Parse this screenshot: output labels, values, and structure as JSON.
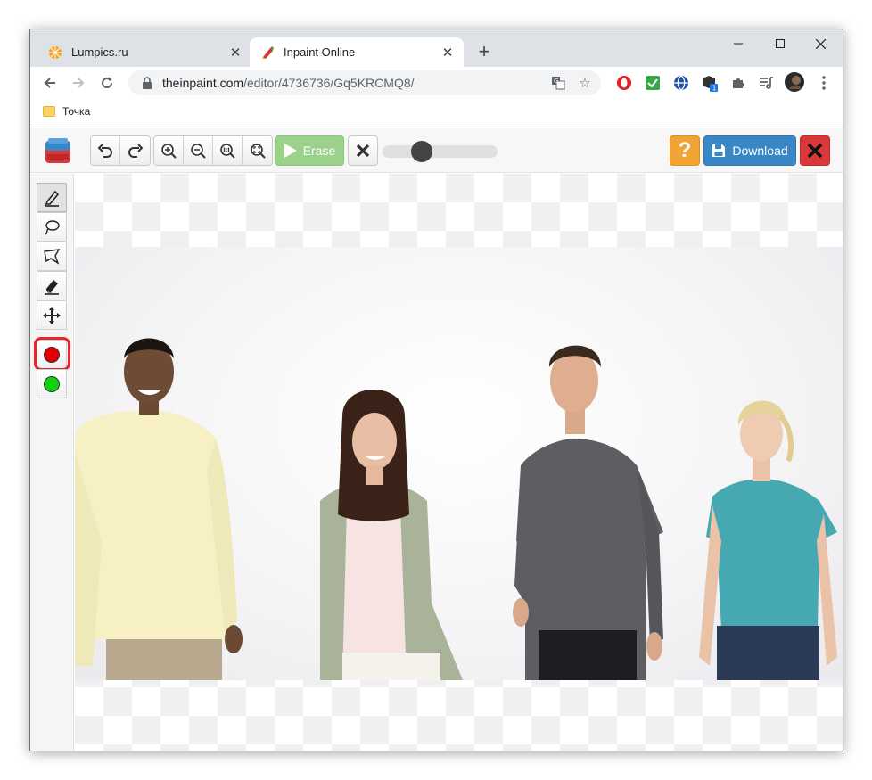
{
  "browser": {
    "tabs": [
      {
        "title": "Lumpics.ru",
        "active": false
      },
      {
        "title": "Inpaint Online",
        "active": true
      }
    ],
    "url_host": "theinpaint.com",
    "url_path": "/editor/4736736/Gq5KRCMQ8/",
    "bookmark": "Точка",
    "extension_badge": "1"
  },
  "app": {
    "erase_label": "Erase",
    "download_label": "Download",
    "help_label": "?",
    "brush_size_fraction": 0.3,
    "colors": {
      "red_marker": "#e00000",
      "green_marker": "#10d010",
      "highlight": "#e8262a"
    }
  }
}
